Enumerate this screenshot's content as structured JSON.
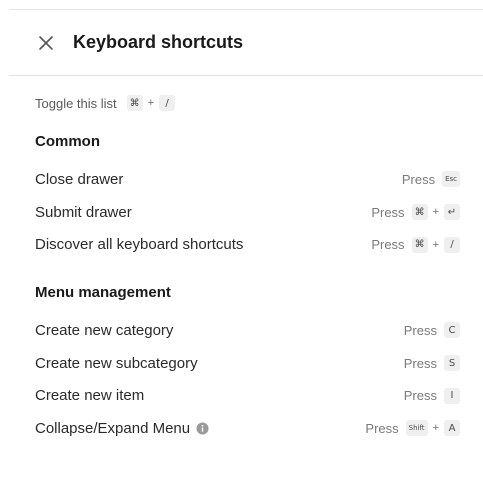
{
  "header": {
    "title": "Keyboard shortcuts"
  },
  "toggle": {
    "label": "Toggle this list",
    "keys": [
      "⌘",
      "/"
    ]
  },
  "press_label": "Press",
  "common": {
    "title": "Common",
    "rows": [
      {
        "label": "Close drawer",
        "keys": [
          "Esc"
        ]
      },
      {
        "label": "Submit drawer",
        "keys": [
          "⌘",
          "↵"
        ]
      },
      {
        "label": "Discover all keyboard shortcuts",
        "keys": [
          "⌘",
          "/"
        ]
      }
    ]
  },
  "menu": {
    "title": "Menu management",
    "rows": [
      {
        "label": "Create new category",
        "keys": [
          "C"
        ]
      },
      {
        "label": "Create new subcategory",
        "keys": [
          "S"
        ]
      },
      {
        "label": "Create new item",
        "keys": [
          "I"
        ]
      },
      {
        "label": "Collapse/Expand Menu",
        "keys": [
          "Shift",
          "A"
        ],
        "info_icon": "info-icon"
      }
    ]
  },
  "plus_sign": "+",
  "colors": {
    "text": "#1f1f1f",
    "muted": "#7a7a7a",
    "key_bg": "#efefef",
    "divider": "#e3e3e3"
  }
}
